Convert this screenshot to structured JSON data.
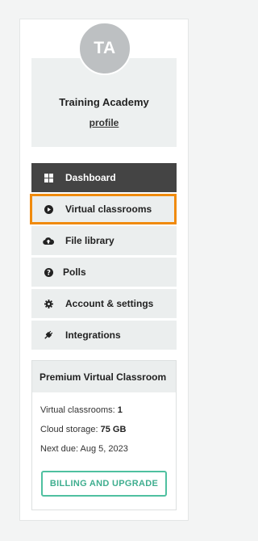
{
  "profile": {
    "initials": "TA",
    "name": "Training Academy",
    "link_label": "profile"
  },
  "menu": {
    "items": [
      {
        "label": "Dashboard",
        "icon": "grid-icon",
        "active": true
      },
      {
        "label": "Virtual classrooms",
        "icon": "play-circle-icon",
        "highlighted": true
      },
      {
        "label": "File library",
        "icon": "cloud-upload-icon"
      },
      {
        "label": "Polls",
        "icon": "question-circle-icon"
      },
      {
        "label": "Account & settings",
        "icon": "gear-icon"
      },
      {
        "label": "Integrations",
        "icon": "plug-icon"
      }
    ]
  },
  "premium": {
    "title": "Premium Virtual Classroom",
    "classrooms_label": "Virtual classrooms:",
    "classrooms_value": "1",
    "storage_label": "Cloud storage:",
    "storage_value": "75 GB",
    "next_due": "Next due: Aug 5, 2023",
    "button_label": "BILLING AND UPGRADE"
  },
  "colors": {
    "active_bg": "#444444",
    "highlight": "#f08a0c",
    "accent": "#4fc0a0"
  }
}
